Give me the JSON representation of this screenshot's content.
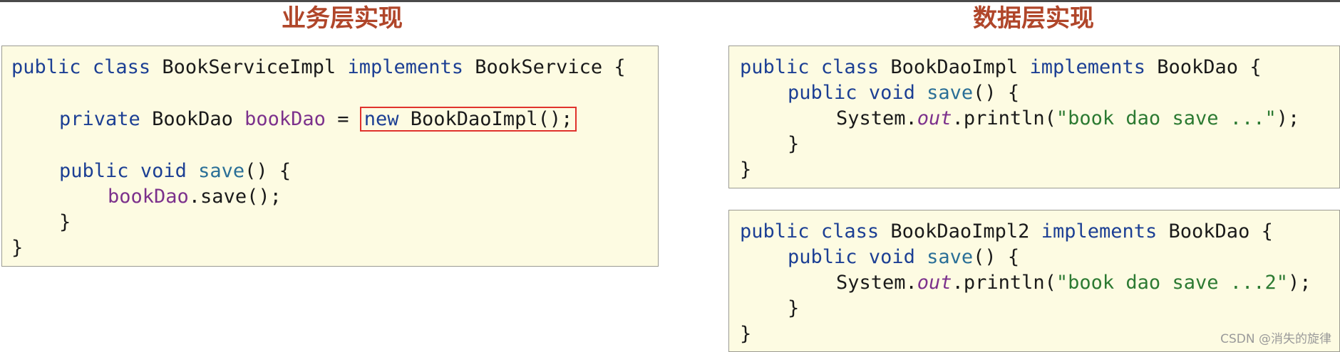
{
  "titles": {
    "business_layer": "业务层实现",
    "data_layer": "数据层实现"
  },
  "service_code": {
    "l1_kw1": "public",
    "l1_kw2": "class",
    "l1_name": "BookServiceImpl",
    "l1_kw3": "implements",
    "l1_iface": "BookService",
    "l1_brace": "{",
    "l3_kw": "private",
    "l3_type": "BookDao",
    "l3_field": "bookDao",
    "l3_eq": "=",
    "l3_new": "new",
    "l3_ctor": "BookDaoImpl();",
    "l5_kw1": "public",
    "l5_kw2": "void",
    "l5_meth": "save",
    "l5_rest": "() {",
    "l6_field": "bookDao",
    "l6_rest": ".save();",
    "l7": "}",
    "l8": "}"
  },
  "dao1_code": {
    "l1_kw1": "public",
    "l1_kw2": "class",
    "l1_name": "BookDaoImpl",
    "l1_kw3": "implements",
    "l1_iface": "BookDao",
    "l1_brace": "{",
    "l2_kw1": "public",
    "l2_kw2": "void",
    "l2_meth": "save",
    "l2_rest": "() {",
    "l3_sys": "System.",
    "l3_out": "out",
    "l3_print": ".println(",
    "l3_str": "\"book dao save ...\"",
    "l3_end": ");",
    "l4": "}",
    "l5": "}"
  },
  "dao2_code": {
    "l1_kw1": "public",
    "l1_kw2": "class",
    "l1_name": "BookDaoImpl2",
    "l1_kw3": "implements",
    "l1_iface": "BookDao",
    "l1_brace": "{",
    "l2_kw1": "public",
    "l2_kw2": "void",
    "l2_meth": "save",
    "l2_rest": "() {",
    "l3_sys": "System.",
    "l3_out": "out",
    "l3_print": ".println(",
    "l3_str": "\"book dao save ...2\"",
    "l3_end": ");",
    "l4": "}",
    "l5": "}"
  },
  "watermark": "CSDN @消失的旋律",
  "colors": {
    "title": "#b0462a",
    "keyword": "#1c3f94",
    "field": "#7c318c",
    "string": "#2c7a32",
    "highlight_border": "#e0322c",
    "code_bg": "#fdfbe2"
  }
}
